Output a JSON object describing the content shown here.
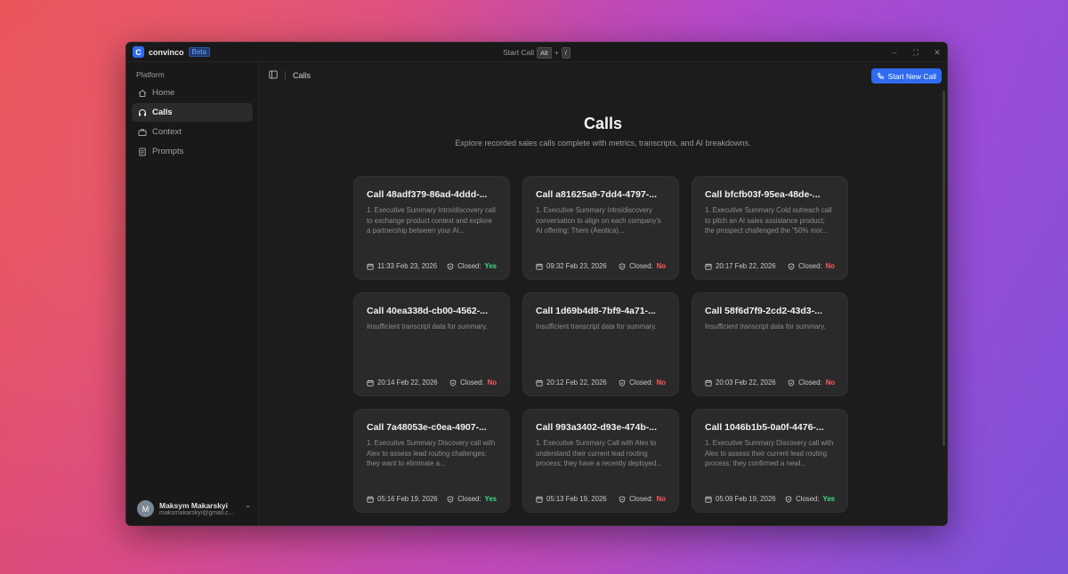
{
  "app": {
    "name": "convinco",
    "logo_letter": "C",
    "badge": "Beta",
    "title_center": "Start Call",
    "shortcut_key1": "Alt",
    "shortcut_plus": "+",
    "shortcut_key2": "/"
  },
  "sidebar": {
    "section_label": "Platform",
    "items": [
      {
        "label": "Home",
        "icon": "home-icon"
      },
      {
        "label": "Calls",
        "icon": "headset-icon",
        "active": true
      },
      {
        "label": "Context",
        "icon": "briefcase-icon"
      },
      {
        "label": "Prompts",
        "icon": "document-icon"
      }
    ],
    "user": {
      "initial": "M",
      "name": "Maksym Makarskyi",
      "email": "maksmakarskyi@gmail.c..."
    }
  },
  "topbar": {
    "breadcrumb": "Calls",
    "start_button": "Start New Call"
  },
  "page": {
    "title": "Calls",
    "subtitle": "Explore recorded sales calls complete with metrics, transcripts, and AI breakdowns."
  },
  "calls": [
    {
      "title": "Call 48adf379-86ad-4ddd-...",
      "summary": "1. Executive Summary Intro/discovery call to exchange product context and explore a partnership between your AI...",
      "datetime": "11:33 Feb 23, 2026",
      "closed_label": "Closed:",
      "closed": "Yes"
    },
    {
      "title": "Call a81625a9-7dd4-4797-...",
      "summary": "1. Executive Summary Intro/discovery conversation to align on each company's AI offering: Them (Aeotica)...",
      "datetime": "09:32 Feb 23, 2026",
      "closed_label": "Closed:",
      "closed": "No"
    },
    {
      "title": "Call bfcfb03f-95ea-48de-...",
      "summary": "1. Executive Summary Cold outreach call to pitch an AI sales assistance product; the prospect challenged the \"50% mor...",
      "datetime": "20:17 Feb 22, 2026",
      "closed_label": "Closed:",
      "closed": "No"
    },
    {
      "title": "Call 40ea338d-cb00-4562-...",
      "summary": "Insufficient transcript data for summary.",
      "datetime": "20:14 Feb 22, 2026",
      "closed_label": "Closed:",
      "closed": "No"
    },
    {
      "title": "Call 1d69b4d8-7bf9-4a71-...",
      "summary": "Insufficient transcript data for summary.",
      "datetime": "20:12 Feb 22, 2026",
      "closed_label": "Closed:",
      "closed": "No"
    },
    {
      "title": "Call 58f6d7f9-2cd2-43d3-...",
      "summary": "Insufficient transcript data for summary.",
      "datetime": "20:03 Feb 22, 2026",
      "closed_label": "Closed:",
      "closed": "No"
    },
    {
      "title": "Call 7a48053e-c0ea-4907-...",
      "summary": "1. Executive Summary Discovery call with Alex to assess lead routing challenges; they want to eliminate a...",
      "datetime": "05:16 Feb 19, 2026",
      "closed_label": "Closed:",
      "closed": "Yes"
    },
    {
      "title": "Call 993a3402-d93e-474b-...",
      "summary": "1. Executive Summary Call with Alex to understand their current lead routing process; they have a recently deployed...",
      "datetime": "05:13 Feb 19, 2026",
      "closed_label": "Closed:",
      "closed": "No"
    },
    {
      "title": "Call 1046b1b5-0a0f-4476-...",
      "summary": "1. Executive Summary Discovery call with Alex to assess their current lead routing process; they confirmed a newl...",
      "datetime": "05:09 Feb 19, 2026",
      "closed_label": "Closed:",
      "closed": "Yes"
    }
  ],
  "colors": {
    "accent": "#2f6bf0",
    "yes": "#3ddc84",
    "no": "#ff5b5b"
  }
}
